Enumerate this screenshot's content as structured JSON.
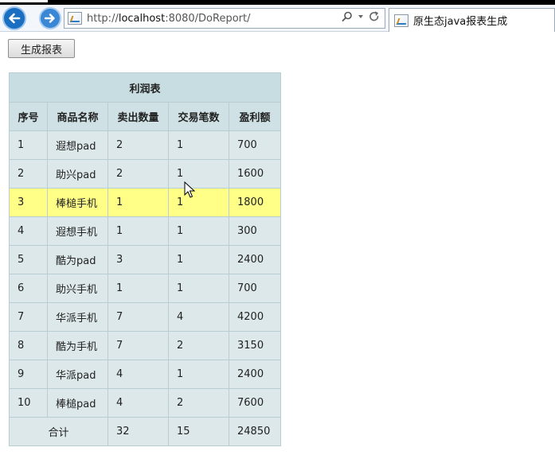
{
  "browser": {
    "url_prefix": "http://",
    "url_host": "localhost",
    "url_rest": ":8080/DoReport/",
    "tab_title": "原生态java报表生成"
  },
  "page": {
    "generate_button": "生成报表"
  },
  "report": {
    "title": "利润表",
    "columns": [
      "序号",
      "商品名称",
      "卖出数量",
      "交易笔数",
      "盈利额"
    ],
    "rows": [
      [
        "1",
        "遐想pad",
        "2",
        "1",
        "700"
      ],
      [
        "2",
        "助兴pad",
        "2",
        "1",
        "1600"
      ],
      [
        "3",
        "棒槌手机",
        "1",
        "1",
        "1800"
      ],
      [
        "4",
        "遐想手机",
        "1",
        "1",
        "300"
      ],
      [
        "5",
        "酷为pad",
        "3",
        "1",
        "2400"
      ],
      [
        "6",
        "助兴手机",
        "1",
        "1",
        "700"
      ],
      [
        "7",
        "华派手机",
        "7",
        "4",
        "4200"
      ],
      [
        "8",
        "酷为手机",
        "7",
        "2",
        "3150"
      ],
      [
        "9",
        "华派pad",
        "4",
        "1",
        "2400"
      ],
      [
        "10",
        "棒槌pad",
        "4",
        "2",
        "7600"
      ]
    ],
    "highlighted_row": 2,
    "highlight_color": "#ffff88",
    "total": {
      "label": "合计",
      "quantity": "32",
      "transactions": "15",
      "profit": "24850"
    }
  }
}
